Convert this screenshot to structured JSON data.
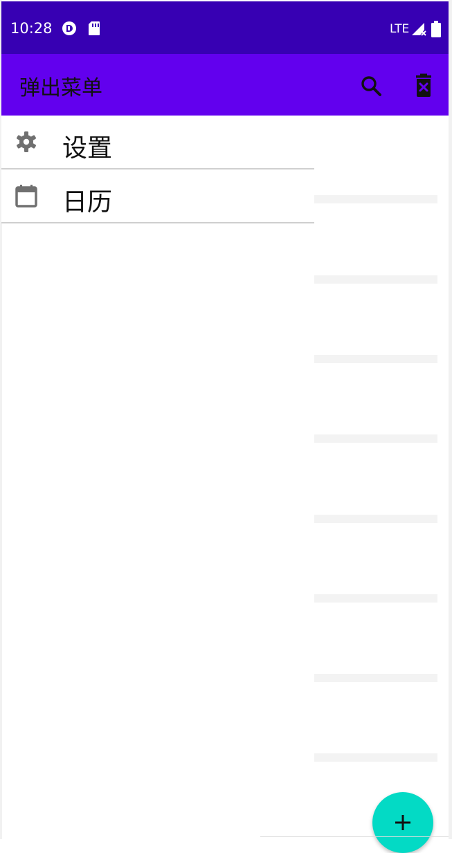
{
  "status_bar": {
    "time": "10:28",
    "network": "LTE",
    "icons": [
      "app-indicator-icon",
      "sd-card-icon",
      "signal-icon",
      "battery-icon"
    ]
  },
  "app_bar": {
    "title": "弹出菜单",
    "actions": [
      {
        "name": "search",
        "icon": "search-icon"
      },
      {
        "name": "delete",
        "icon": "delete-icon"
      }
    ]
  },
  "popup_menu": {
    "items": [
      {
        "label": "设置",
        "icon": "gear-icon"
      },
      {
        "label": "日历",
        "icon": "calendar-icon"
      }
    ]
  },
  "fab": {
    "icon": "plus-icon"
  },
  "colors": {
    "status_bar": "#3700b3",
    "app_bar": "#6200ee",
    "fab": "#03dac5",
    "menu_icon": "#707070"
  }
}
